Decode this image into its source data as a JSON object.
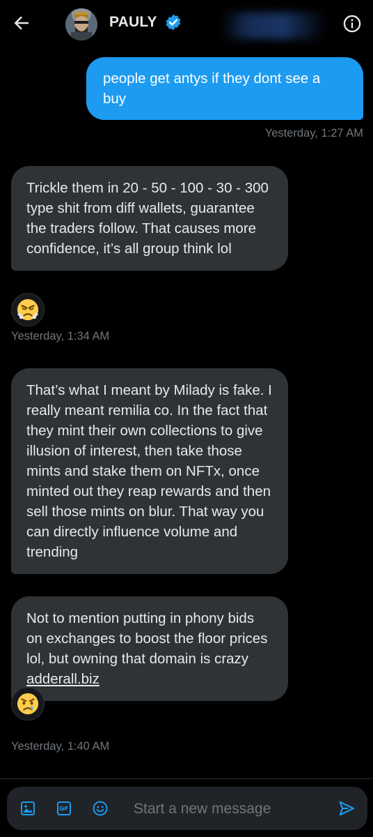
{
  "header": {
    "name": "PAULY"
  },
  "messages": [
    {
      "text": "people get antys if they dont see a buy",
      "timestamp": "Yesterday, 1:27 AM"
    },
    {
      "text": "Trickle them in 20 - 50 - 100 - 30 - 300 type shit from diff wallets, guarantee the traders follow. That causes more confidence, it’s all group think lol",
      "reaction": "angry-face-emoji",
      "timestamp": "Yesterday, 1:34 AM"
    },
    {
      "text": "That’s what I meant by Milady is fake. I really meant remilia co. In the fact that they mint their own collections to give illusion of interest, then take those mints and stake them on NFTx, once minted out they reap rewards and then sell those mints on blur. That way you can directly influence volume and trending"
    },
    {
      "text": "Not to mention putting in phony bids on exchanges to boost the floor prices lol, but owning that domain is crazy ",
      "link": "adderall.biz",
      "reaction": "crying-face-emoji",
      "timestamp": "Yesterday, 1:40 AM"
    }
  ],
  "composer": {
    "placeholder": "Start a new message"
  },
  "colors": {
    "background": "#000000",
    "sent_bubble": "#1d9bf0",
    "received_bubble": "#2f3336",
    "muted_text": "#71767b",
    "accent": "#1d9bf0"
  }
}
